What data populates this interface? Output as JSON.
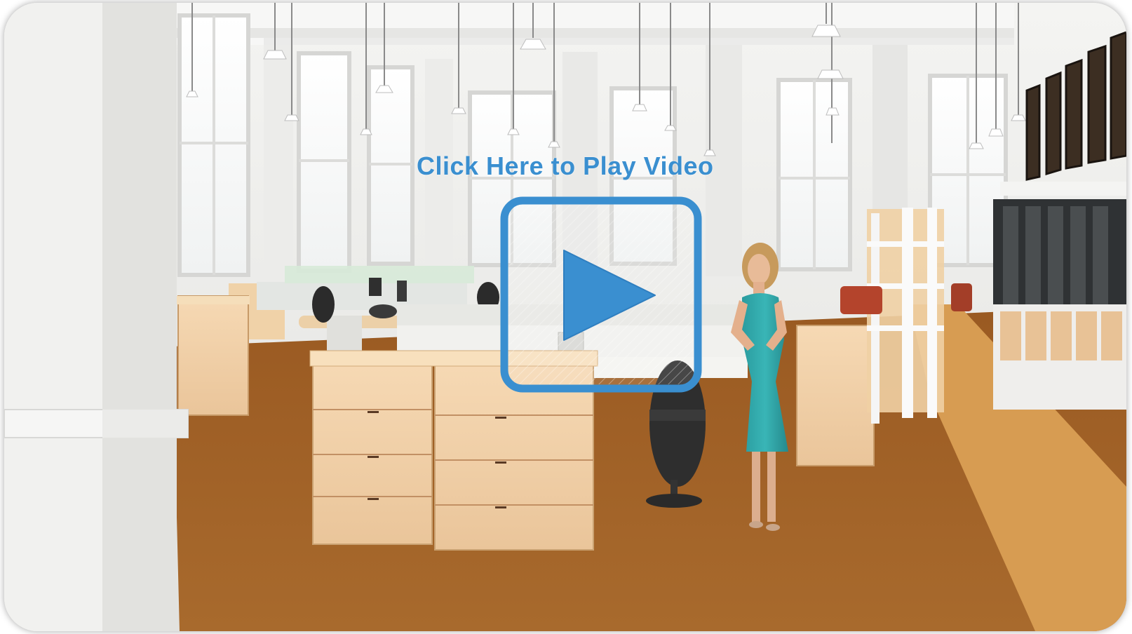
{
  "video": {
    "cta_text": "Click Here to Play Video",
    "accent_color": "#3a8fd0"
  },
  "icons": {
    "play": "play-icon"
  }
}
